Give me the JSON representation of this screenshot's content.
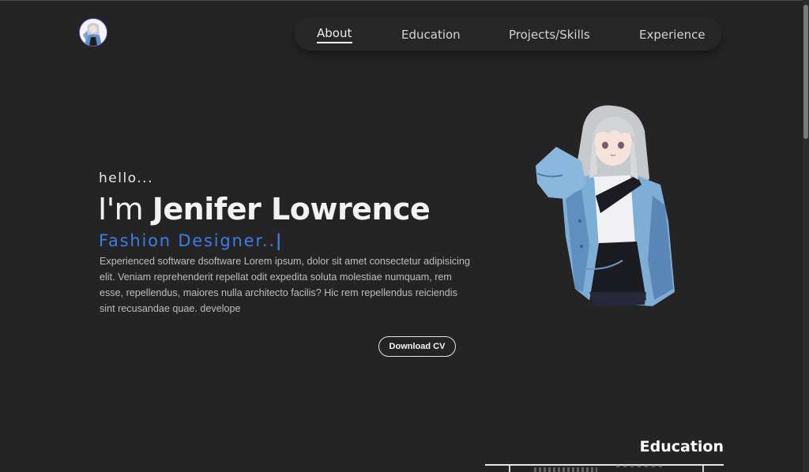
{
  "header": {
    "logo_icon": "avatar-logo",
    "nav": [
      {
        "label": "About",
        "active": true
      },
      {
        "label": "Education",
        "active": false
      },
      {
        "label": "Projects/Skills",
        "active": false
      },
      {
        "label": "Experience",
        "active": false
      }
    ]
  },
  "hero": {
    "greeting": "hello...",
    "headline_prefix": "I'm ",
    "name": "Jenifer Lowrence",
    "role": "Fashion Designer..",
    "caret": "|",
    "bio": "Experienced software dsoftware Lorem ipsum, dolor sit amet consectetur adipisicing elit. Veniam reprehenderit repellat odit expedita soluta molestiae numquam, rem esse, repellendus, maiores nulla architecto facilis? Hic rem repellendus reiciendis sint recusandae quae. develope",
    "download_button": "Download CV",
    "illustration_icon": "anime-character-illustration"
  },
  "education": {
    "title": "Education"
  },
  "colors": {
    "background": "#242424",
    "accent": "#3c7de8",
    "text": "#f2f2f2"
  }
}
